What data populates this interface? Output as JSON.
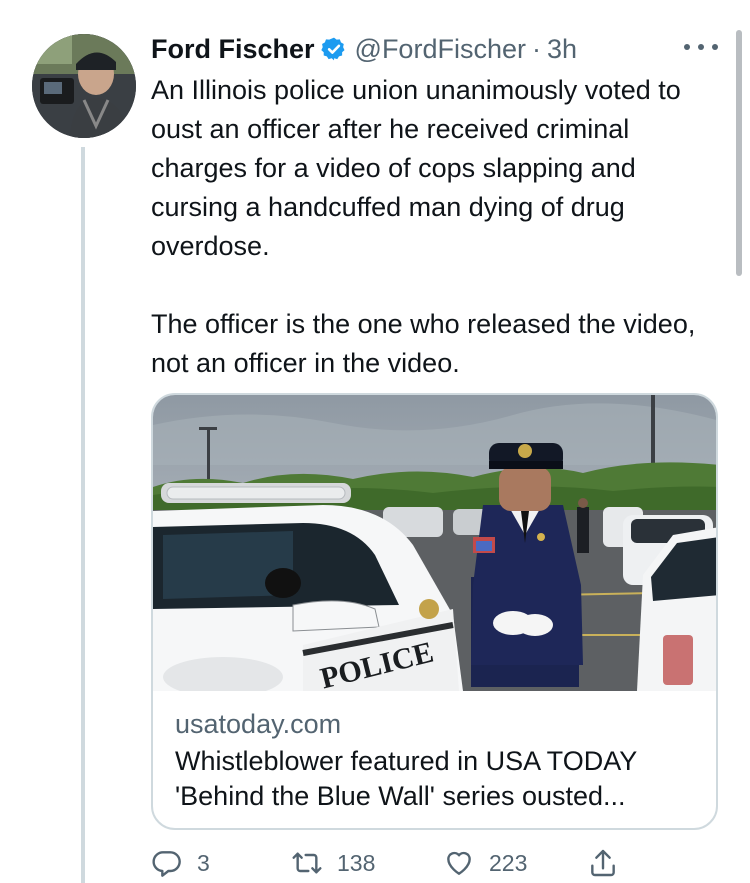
{
  "author": {
    "name": "Ford Fischer",
    "handle": "@FordFischer",
    "separator": "·",
    "time": "3h",
    "verified": true
  },
  "tweet": {
    "paragraphs": [
      "An Illinois police union unanimously voted to oust an officer after he received criminal charges for a video of cops slapping and cursing a handcuffed man dying of drug overdose.",
      "The officer is the one who released the video, not an officer in the video."
    ]
  },
  "card": {
    "domain": "usatoday.com",
    "title": "Whistleblower featured in USA TODAY 'Behind the Blue Wall' series ousted...",
    "car_lettering": "POLICE"
  },
  "actions": {
    "reply_count": "3",
    "retweet_count": "138",
    "like_count": "223"
  },
  "icons": {
    "verified": "verified-badge-icon",
    "more": "more-dots-icon",
    "reply": "reply-icon",
    "retweet": "retweet-icon",
    "like": "heart-icon",
    "share": "share-icon"
  },
  "colors": {
    "text": "#0f1419",
    "secondary": "#536471",
    "verified": "#1d9bf0",
    "border": "#cfd9de"
  }
}
